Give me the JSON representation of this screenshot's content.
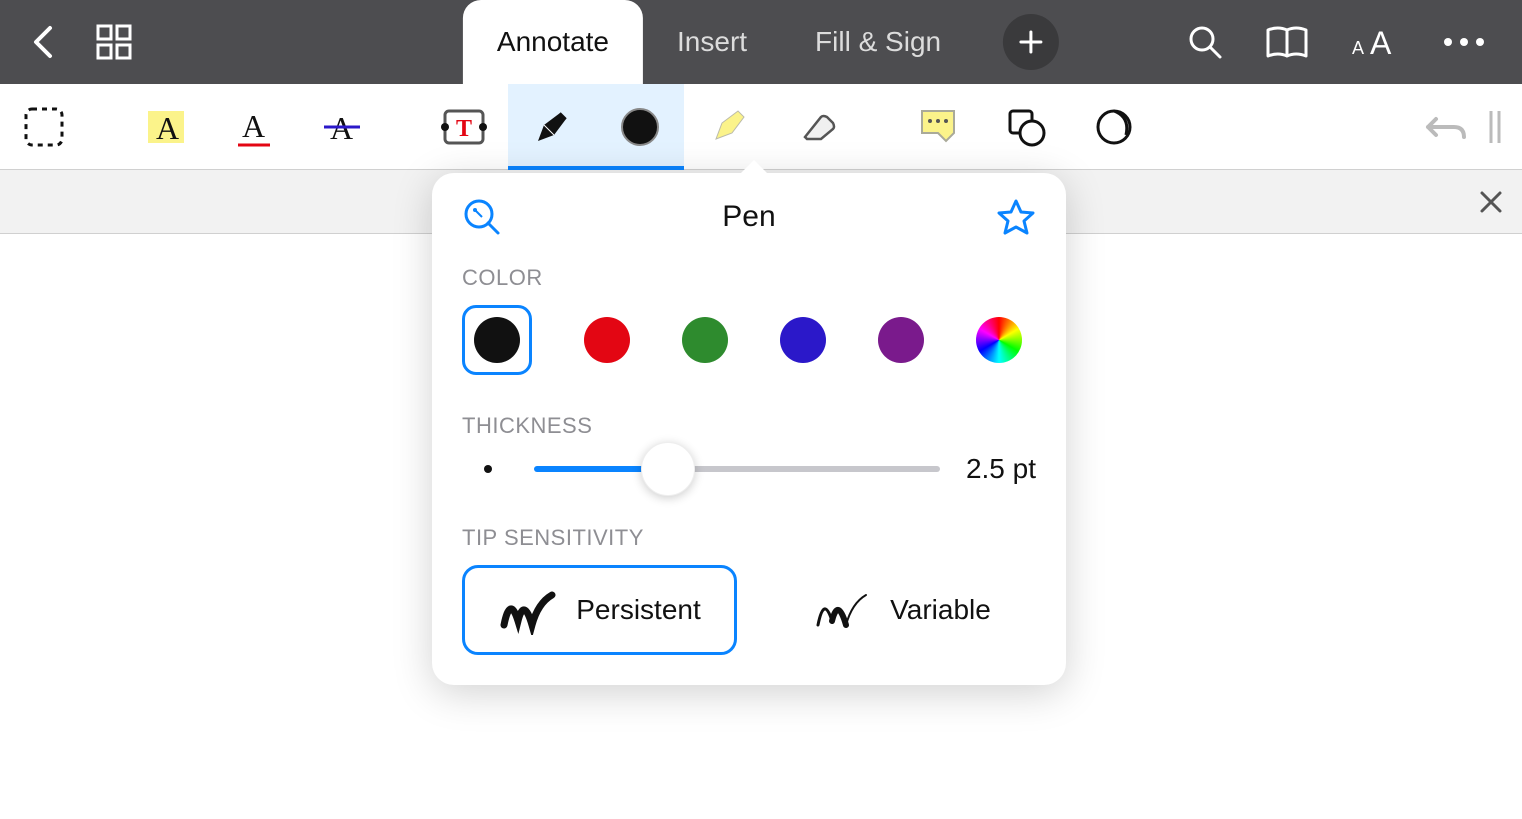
{
  "topbar": {
    "tabs": [
      {
        "id": "annotate",
        "label": "Annotate",
        "active": true
      },
      {
        "id": "insert",
        "label": "Insert",
        "active": false
      },
      {
        "id": "fill-sign",
        "label": "Fill & Sign",
        "active": false
      }
    ]
  },
  "toolbar": {
    "tools": [
      {
        "id": "selection",
        "icon": "selection-dashed-icon"
      },
      {
        "id": "highlight-text",
        "icon": "highlight-text-icon"
      },
      {
        "id": "underline-text",
        "icon": "underline-text-icon"
      },
      {
        "id": "strikethrough-text",
        "icon": "strikethrough-text-icon"
      },
      {
        "id": "text-box",
        "icon": "text-box-icon"
      },
      {
        "id": "pen",
        "icon": "pen-icon",
        "selected": true
      },
      {
        "id": "pen-color",
        "icon": "color-circle-icon",
        "selected": true
      },
      {
        "id": "freehand-highlighter",
        "icon": "freehand-highlighter-icon"
      },
      {
        "id": "eraser",
        "icon": "eraser-icon"
      },
      {
        "id": "sticky-note",
        "icon": "sticky-note-icon"
      },
      {
        "id": "shapes",
        "icon": "shapes-icon"
      },
      {
        "id": "stamp",
        "icon": "stamp-icon"
      }
    ]
  },
  "popover": {
    "title": "Pen",
    "color_label": "COLOR",
    "thickness_label": "THICKNESS",
    "tip_label": "TIP SENSITIVITY",
    "colors": [
      {
        "name": "black",
        "hex": "#111111",
        "selected": true
      },
      {
        "name": "red",
        "hex": "#e30613",
        "selected": false
      },
      {
        "name": "green",
        "hex": "#2e8b2e",
        "selected": false
      },
      {
        "name": "blue",
        "hex": "#2b18c9",
        "selected": false
      },
      {
        "name": "purple",
        "hex": "#7a1a8c",
        "selected": false
      },
      {
        "name": "custom",
        "hex": "wheel",
        "selected": false
      }
    ],
    "thickness_value": "2.5 pt",
    "thickness_fraction": 0.33,
    "tips": [
      {
        "id": "persistent",
        "label": "Persistent",
        "selected": true
      },
      {
        "id": "variable",
        "label": "Variable",
        "selected": false
      }
    ]
  }
}
